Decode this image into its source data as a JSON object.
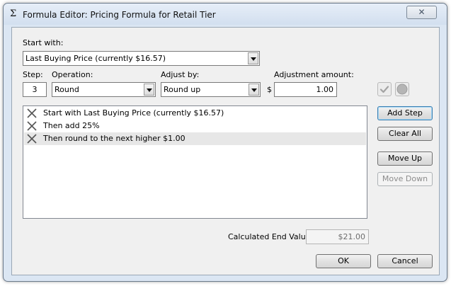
{
  "window": {
    "title_icon": "Σ",
    "title": "Formula Editor: Pricing Formula for Retail Tier",
    "close_glyph": "✕"
  },
  "start_with": {
    "label": "Start with:",
    "value": "Last Buying Price (currently $16.57)"
  },
  "step": {
    "label": "Step:",
    "value": "3"
  },
  "operation": {
    "label": "Operation:",
    "value": "Round"
  },
  "adjust_by": {
    "label": "Adjust by:",
    "value": "Round up"
  },
  "adjustment_amount": {
    "label": "Adjustment amount:",
    "currency": "$",
    "value": "1.00"
  },
  "icons": {
    "apply": "check-icon",
    "status": "circle-icon"
  },
  "steps": [
    {
      "icon": "delete-x-icon",
      "text": "Start with Last Buying Price (currently $16.57)",
      "selected": false
    },
    {
      "icon": "delete-x-icon",
      "text": "Then add 25%",
      "selected": false
    },
    {
      "icon": "delete-x-icon",
      "text": "Then round to the next higher $1.00",
      "selected": true
    }
  ],
  "buttons": {
    "add_step": "Add Step",
    "clear_all": "Clear All",
    "move_up": "Move Up",
    "move_down": "Move Down",
    "ok": "OK",
    "cancel": "Cancel"
  },
  "end_value": {
    "label": "Calculated End Value:",
    "value": "$21.00"
  },
  "colors": {
    "title_bar": "#d2dfef",
    "client_bg": "#f0f0f0",
    "selected_row": "#e7e7e7"
  }
}
